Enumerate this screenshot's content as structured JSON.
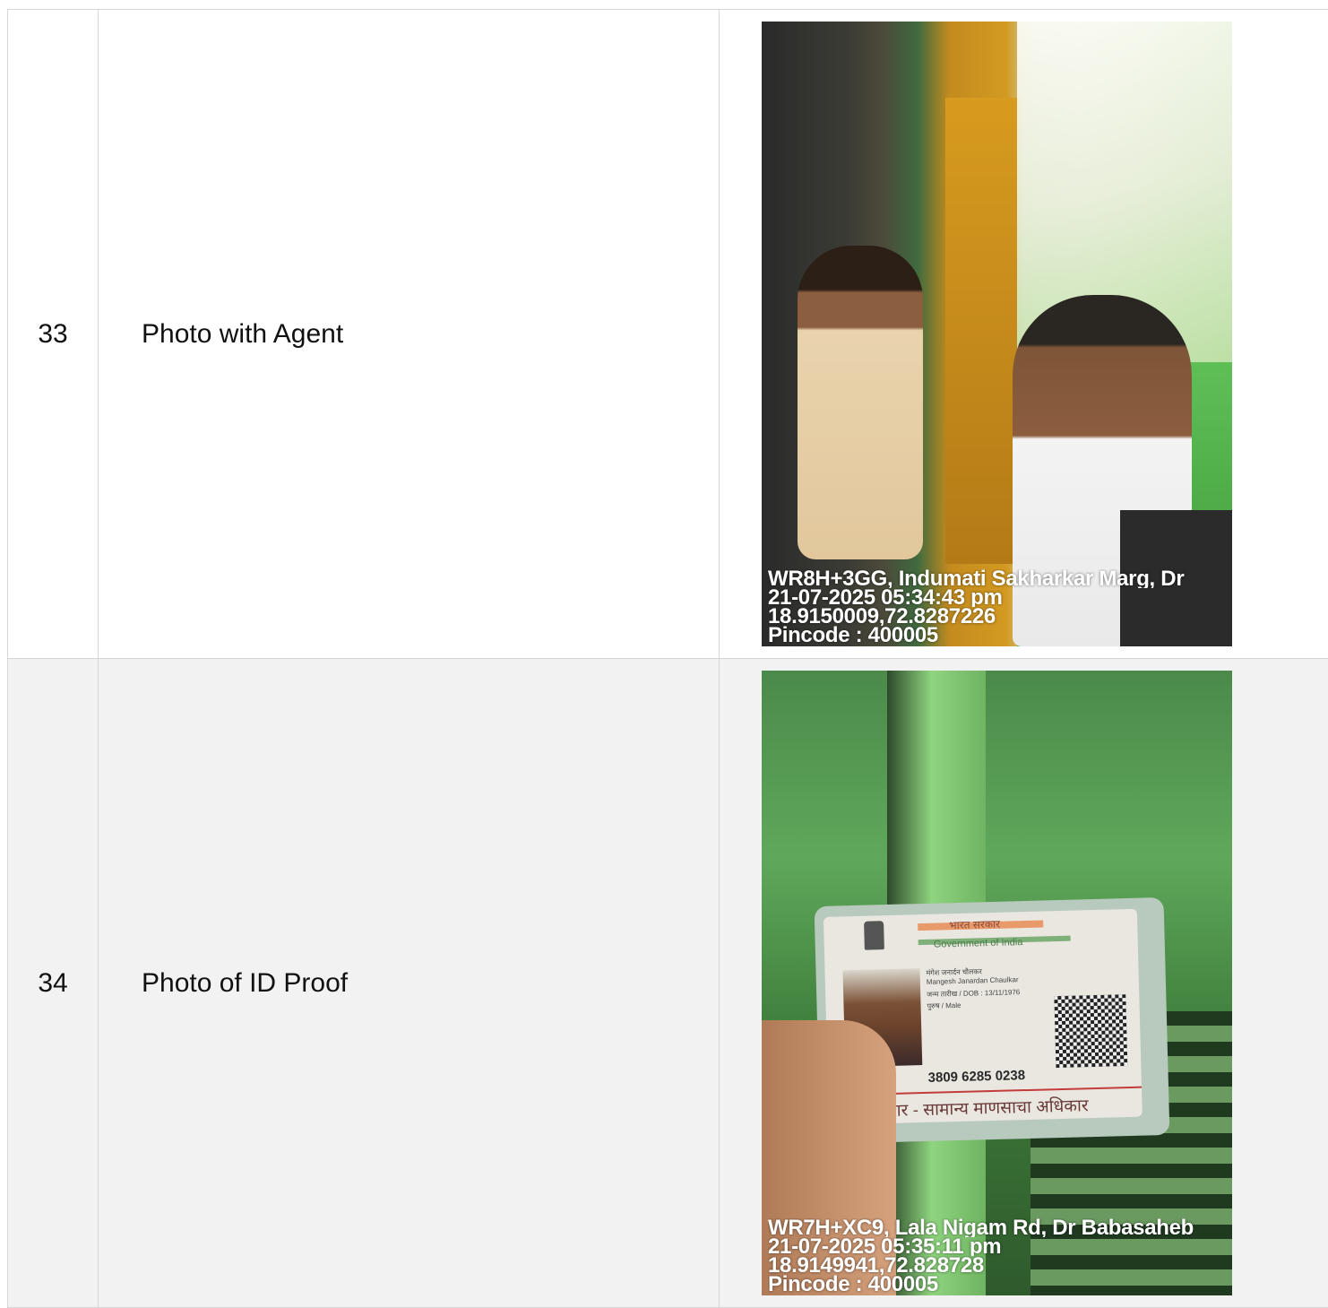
{
  "rows": [
    {
      "number": "33",
      "label": "Photo with Agent",
      "photo": {
        "stamp_address": "WR8H+3GG, Indumati Sakharkar Marg, Dr",
        "stamp_datetime": "21-07-2025 05:34:43 pm",
        "stamp_coords": "18.9150009,72.8287226",
        "stamp_pincode": "Pincode : 400005"
      }
    },
    {
      "number": "34",
      "label": "Photo of ID Proof",
      "photo": {
        "card": {
          "hindi_header": "भारत सरकार",
          "gov_text": "Government of India",
          "name_marathi": "मंगेश जनार्दन चौलकर",
          "name": "Mangesh Janardan Chaulkar",
          "dob": "जन्म तारीख / DOB : 13/11/1976",
          "gender": "पुरुष / Male",
          "aadhaar_number": "3809 6285 0238",
          "footer": "आधार - सामान्य माणसाचा अधिकार"
        },
        "stamp_address": "WR7H+XC9, Lala Nigam Rd, Dr Babasaheb",
        "stamp_datetime": "21-07-2025 05:35:11 pm",
        "stamp_coords": "18.9149941,72.828728",
        "stamp_pincode": "Pincode : 400005"
      }
    }
  ]
}
